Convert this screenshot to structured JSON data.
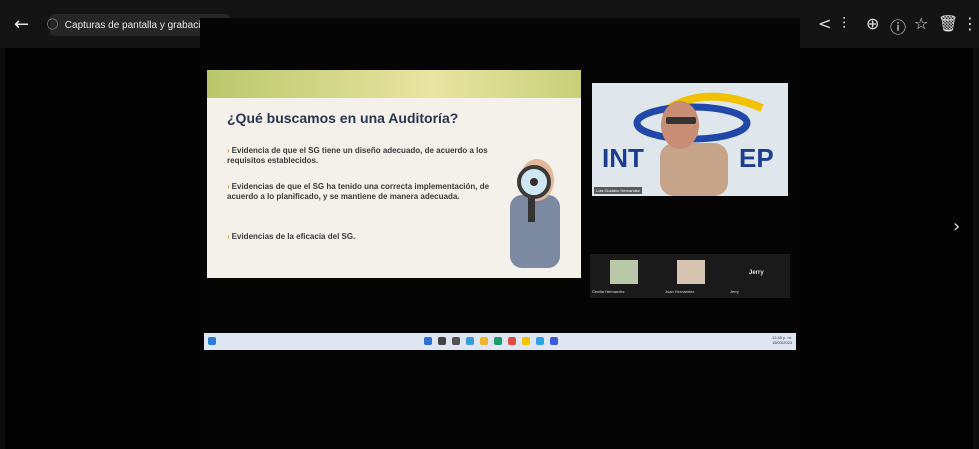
{
  "viewer": {
    "back_icon": "←",
    "album_icon": "⃝",
    "album_label": "Capturas de pantalla y grabaciones",
    "share_icon": "<",
    "edit_icon": "⫶",
    "zoom_icon": "⊕",
    "info_icon": "ⓘ",
    "star_icon": "☆",
    "delete_icon": "🗑",
    "more_icon": "⋮",
    "next_icon": "›"
  },
  "slide": {
    "title": "¿Qué buscamos en una Auditoría?",
    "bullets": [
      "Evidencia de que el SG tiene un diseño adecuado, de acuerdo a los requisitos establecidos.",
      "Evidencias de que el SG ha tenido una correcta implementación, de acuerdo a lo planificado, y se mantiene de manera adecuada.",
      "Evidencias de la eficacia del SG."
    ]
  },
  "meeting": {
    "speaker_label": "Luis Gustavo Hernandez",
    "tiles": [
      "Cecilia Hernandez",
      "Juan Hernandez",
      "Jerry"
    ],
    "jerry_name": "Jerry"
  },
  "taskbar": {
    "time": "12:45 p. m.",
    "date": "15/03/2023"
  }
}
